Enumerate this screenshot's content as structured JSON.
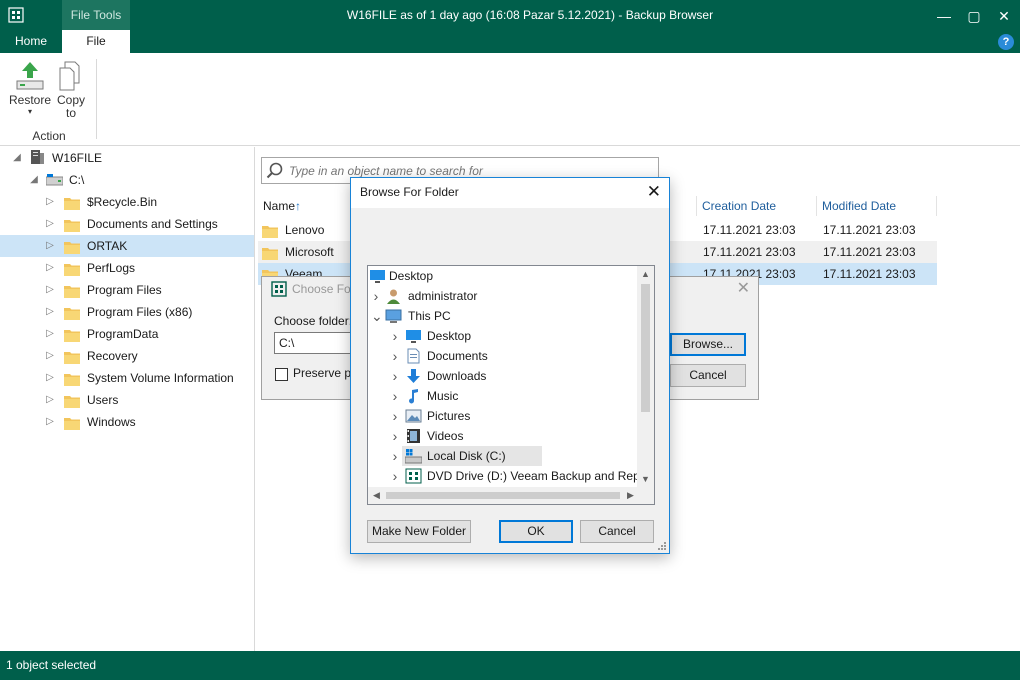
{
  "window": {
    "title": "W16FILE as of 1 day ago (16:08 Pazar 5.12.2021) - Backup Browser",
    "context_tab": "File Tools",
    "minimize_icon": "minimize-icon",
    "maximize_icon": "maximize-icon",
    "close_icon": "close-icon",
    "help_label": "?"
  },
  "tabs": {
    "home": "Home",
    "file": "File"
  },
  "ribbon": {
    "restore_label": "Restore",
    "restore_arrow": "▾",
    "copy_label_1": "Copy",
    "copy_label_2": "to",
    "group_label": "Action"
  },
  "tree": {
    "server": "W16FILE",
    "drive": "C:\\",
    "folders": [
      "$Recycle.Bin",
      "Documents and Settings",
      "ORTAK",
      "PerfLogs",
      "Program Files",
      "Program Files (x86)",
      "ProgramData",
      "Recovery",
      "System Volume Information",
      "Users",
      "Windows"
    ],
    "selected_folder": "ORTAK"
  },
  "search": {
    "placeholder": "Type in an object name to search for"
  },
  "list": {
    "columns": {
      "name": "Name",
      "sort_arrow": "↑",
      "created": "Creation Date",
      "modified": "Modified Date"
    },
    "rows": [
      {
        "name": "Lenovo",
        "created": "17.11.2021 23:03",
        "modified": "17.11.2021 23:03"
      },
      {
        "name": "Microsoft",
        "created": "17.11.2021 23:03",
        "modified": "17.11.2021 23:03"
      },
      {
        "name": "Veeam",
        "created": "17.11.2021 23:03",
        "modified": "17.11.2021 23:03"
      }
    ]
  },
  "choose_dialog": {
    "title": "Choose Fol",
    "folder_label": "Choose folder:",
    "folder_value": "C:\\",
    "preserve_label": "Preserve pe",
    "browse_label": "Browse...",
    "cancel_label": "Cancel"
  },
  "browse_dialog": {
    "title": "Browse For Folder",
    "items": [
      {
        "label": "Desktop",
        "icon": "desktop-icon"
      },
      {
        "label": "administrator",
        "icon": "user-icon"
      },
      {
        "label": "This PC",
        "icon": "computer-icon"
      },
      {
        "label": "Desktop",
        "icon": "desktop-icon"
      },
      {
        "label": "Documents",
        "icon": "documents-icon"
      },
      {
        "label": "Downloads",
        "icon": "downloads-icon"
      },
      {
        "label": "Music",
        "icon": "music-icon"
      },
      {
        "label": "Pictures",
        "icon": "pictures-icon"
      },
      {
        "label": "Videos",
        "icon": "videos-icon"
      },
      {
        "label": "Local Disk (C:)",
        "icon": "local-disk-icon"
      },
      {
        "label": "DVD Drive (D:) Veeam Backup and Replic",
        "icon": "dvd-drive-icon"
      }
    ],
    "make_folder_label": "Make New Folder",
    "ok_label": "OK",
    "cancel_label": "Cancel"
  },
  "status": {
    "text": "1 object selected"
  },
  "colors": {
    "accent": "#005f4b",
    "selection": "#cce4f7",
    "link": "#1f5e9c"
  }
}
